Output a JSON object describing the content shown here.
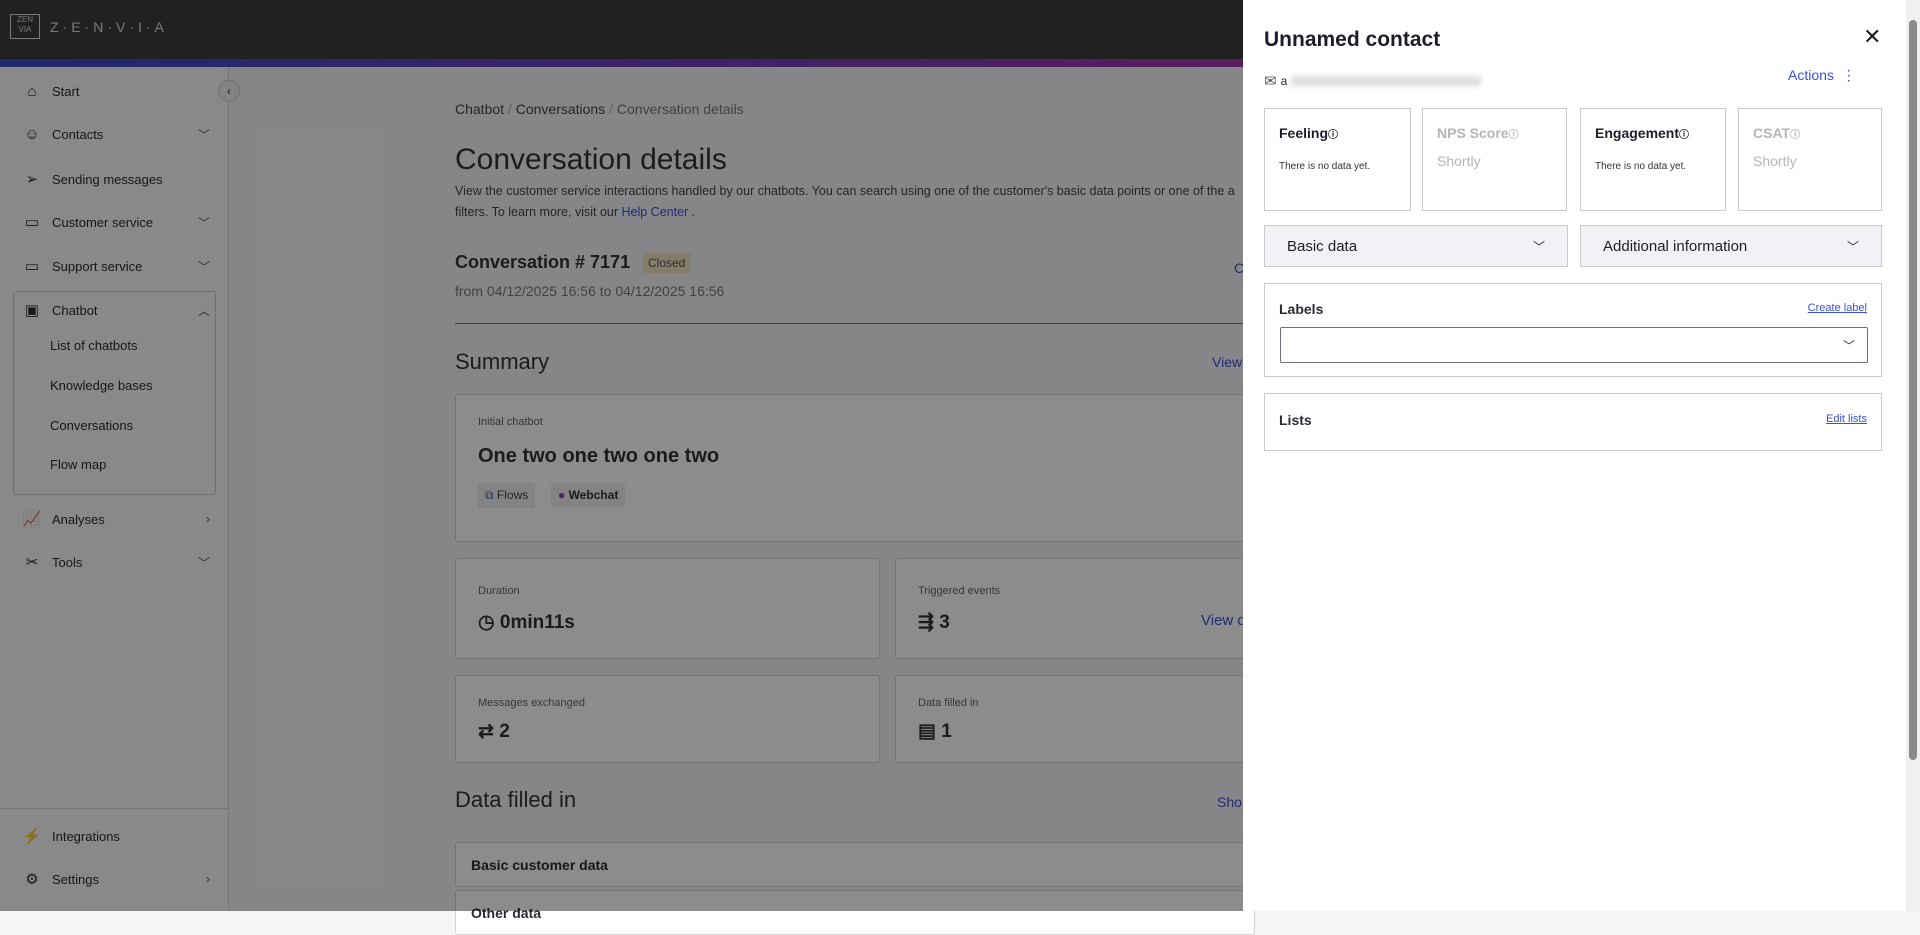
{
  "brand": {
    "logo_text": "ZENVIA",
    "wordmark": "Z·E·N·V·I·A"
  },
  "sidebar": {
    "items": [
      {
        "label": "Start",
        "icon": "home-icon"
      },
      {
        "label": "Contacts",
        "icon": "user-icon"
      },
      {
        "label": "Sending messages",
        "icon": "send-icon"
      },
      {
        "label": "Customer service",
        "icon": "chat-icon"
      },
      {
        "label": "Support service",
        "icon": "ticket-icon"
      },
      {
        "label": "Chatbot",
        "icon": "robot-icon"
      },
      {
        "label": "Analyses",
        "icon": "chart-icon"
      },
      {
        "label": "Tools",
        "icon": "tools-icon"
      },
      {
        "label": "Integrations",
        "icon": "lightning-icon"
      },
      {
        "label": "Settings",
        "icon": "gear-icon"
      }
    ],
    "chatbot_sub": [
      "List of chatbots",
      "Knowledge bases",
      "Conversations",
      "Flow map"
    ]
  },
  "breadcrumb": [
    "Chatbot",
    "Conversations",
    "Conversation details"
  ],
  "page": {
    "title": "Conversation details",
    "desc1": "View the customer service interactions handled by our chatbots. You can search using one of the customer's basic data points or one of the a",
    "desc2": "filters. To learn more, visit our ",
    "help_link": "Help Center",
    "desc_end": " .",
    "conv_title": "Conversation # 7171",
    "status": "Closed",
    "date_range": "from 04/12/2025 16:56 to 04/12/2025 16:56",
    "conv_link": "C",
    "summary": "Summary",
    "summary_link": "View",
    "initial_label": "Initial chatbot",
    "initial_name": "One two one two one two",
    "chip_flows": "Flows",
    "chip_webchat": "Webchat",
    "duration_label": "Duration",
    "duration": "0min11s",
    "events_label": "Triggered events",
    "events": "3",
    "events_link": "View d",
    "messages_label": "Messages exchanged",
    "messages": "2",
    "filled_label": "Data filled in",
    "filled": "1",
    "data_title": "Data filled in",
    "data_link": "Sho",
    "rows": [
      "Basic customer data",
      "Other data"
    ]
  },
  "panel": {
    "title": "Unnamed contact",
    "email_prefix": "a",
    "actions": "Actions",
    "metrics": [
      {
        "title": "Feeling",
        "value": "There is no data yet.",
        "disabled": false
      },
      {
        "title": "NPS Score",
        "value": "Shortly",
        "disabled": true
      },
      {
        "title": "Engagement",
        "value": "There is no data yet.",
        "disabled": false
      },
      {
        "title": "CSAT",
        "value": "Shortly",
        "disabled": true
      }
    ],
    "basic_data": "Basic data",
    "additional": "Additional information",
    "labels": "Labels",
    "create_label": "Create label",
    "labels_value": "",
    "lists": "Lists",
    "edit_lists": "Edit lists"
  }
}
